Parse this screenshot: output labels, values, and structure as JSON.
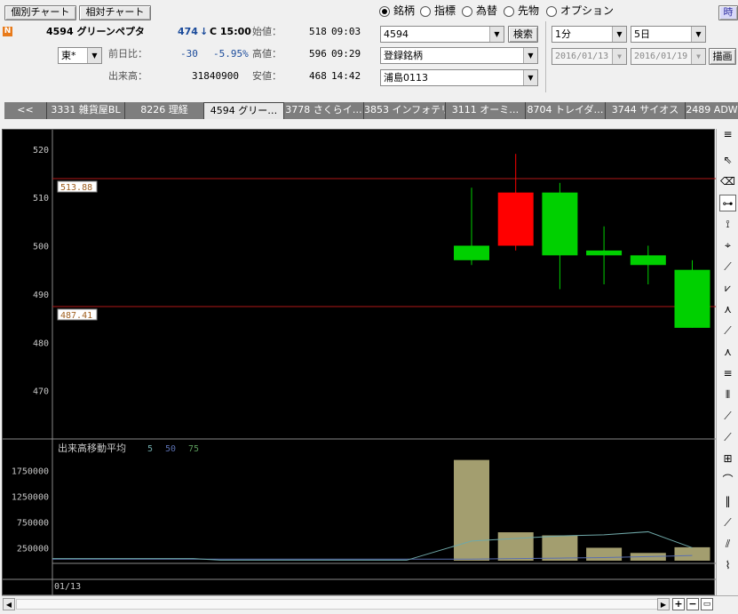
{
  "header": {
    "chart_single_btn": "個別チャート",
    "chart_relative_btn": "相対チャート",
    "n_badge": "N",
    "stock_code_name": "4594 グリーンペプタ",
    "price": "474",
    "price_arrow": "↓",
    "price_time": "C 15:00",
    "market_select": "東",
    "market_select_suffix": "*",
    "change_label": "前日比：",
    "change_value": "-30",
    "change_pct": "-5.95%",
    "volume_label": "出来高：",
    "volume_value": "31840900",
    "open_label": "始値：",
    "open_value": "518",
    "open_time": "09:03",
    "high_label": "高値：",
    "high_value": "596",
    "high_time": "09:29",
    "low_label": "安値：",
    "low_value": "468",
    "low_time": "14:42"
  },
  "radios": [
    {
      "label": "銘柄",
      "checked": true
    },
    {
      "label": "指標",
      "checked": false
    },
    {
      "label": "為替",
      "checked": false
    },
    {
      "label": "先物",
      "checked": false
    },
    {
      "label": "オプション",
      "checked": false
    }
  ],
  "controls": {
    "symbol_input": "4594",
    "search_btn": "検索",
    "list_combo": "登録銘柄",
    "group_combo": "浦島0113",
    "interval_combo": "1分",
    "period_combo": "5日",
    "date_from": "2016/01/13",
    "date_to": "2016/01/19",
    "draw_btn": "描画",
    "corner_btn": "時"
  },
  "tabs": [
    {
      "label": "<<",
      "active": false
    },
    {
      "label": "3331 雑貨屋BL",
      "active": false
    },
    {
      "label": "8226 理経",
      "active": false
    },
    {
      "label": "4594 グリー…",
      "active": true
    },
    {
      "label": "3778 さくらイ…",
      "active": false
    },
    {
      "label": "3853 インフォテリ",
      "active": false
    },
    {
      "label": "3111 オーミ…",
      "active": false
    },
    {
      "label": "8704 トレイダ…",
      "active": false
    },
    {
      "label": "3744 サイオス",
      "active": false
    },
    {
      "label": "2489 ADW",
      "active": false
    }
  ],
  "volume_panel": {
    "title": "出来高移動平均",
    "ma_periods": [
      "5",
      "50",
      "75"
    ],
    "ma_colors": [
      "#6fa8a8",
      "#5a6fb0",
      "#5a9a5a"
    ],
    "x_label": "01/13"
  },
  "colors": {
    "up": "#ff0000",
    "down": "#00d000",
    "volume_bar": "#a39e6f",
    "hline": "#b01818"
  },
  "chart_data": [
    {
      "type": "candlestick",
      "yticks": [
        520,
        510,
        500,
        490,
        480,
        470
      ],
      "ylim": [
        460,
        524
      ],
      "hlines": [
        513.88,
        487.41
      ],
      "candles": [
        {
          "open": 500,
          "close": 497,
          "high": 512,
          "low": 496
        },
        {
          "open": 500,
          "close": 511,
          "high": 519,
          "low": 499
        },
        {
          "open": 511,
          "close": 498,
          "high": 513,
          "low": 491
        },
        {
          "open": 499,
          "close": 498,
          "high": 504,
          "low": 492
        },
        {
          "open": 498,
          "close": 496,
          "high": 500,
          "low": 492
        },
        {
          "open": 495,
          "close": 483,
          "high": 497,
          "low": 483
        }
      ]
    },
    {
      "type": "bar",
      "yticks": [
        1750000,
        1250000,
        750000,
        250000
      ],
      "ylim": [
        0,
        2150000
      ],
      "values": [
        1950000,
        550000,
        490000,
        250000,
        150000,
        260000
      ],
      "series": [
        {
          "name": "5",
          "values": [
            null,
            430000,
            480000,
            500000,
            560000,
            250000
          ]
        },
        {
          "name": "50",
          "values": [
            30000,
            40000,
            50000,
            60000,
            80000,
            100000
          ]
        }
      ]
    }
  ],
  "toolbar": [
    "cursor-arrow",
    "eraser",
    "hline",
    "vline",
    "crosshair",
    "trendline",
    "pitchfork",
    "fan",
    "channel",
    "speed-fan",
    "fib-retracement",
    "cycle-lines",
    "ray",
    "regression",
    "gann",
    "fib-arc",
    "fib-time",
    "fib-ext",
    "parallel",
    "spiral"
  ]
}
